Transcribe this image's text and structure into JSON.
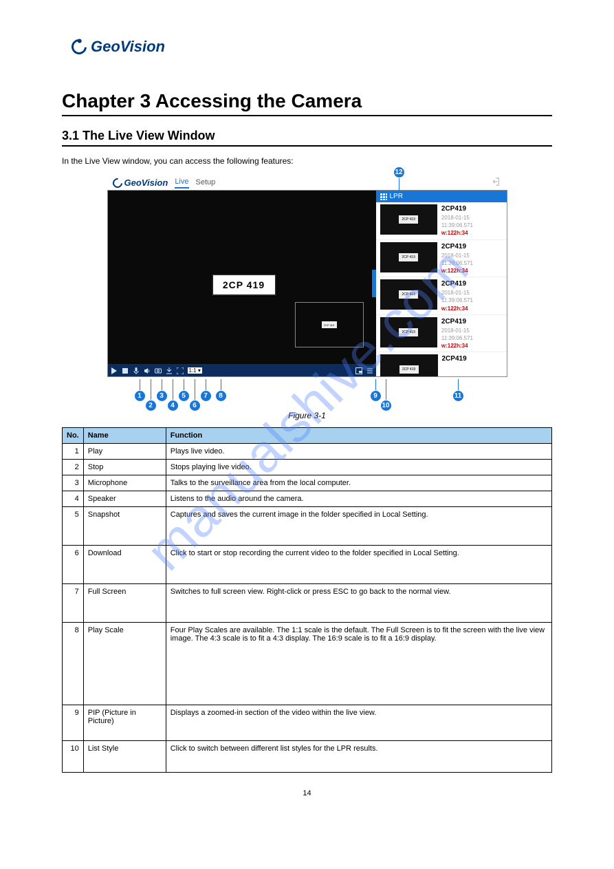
{
  "header": {
    "logo_text": "GeoVision"
  },
  "chapter_title": "Chapter 3 Accessing the Camera",
  "section_title": "3.1 The Live View Window",
  "intro": "In the Live View window, you can access the following features:",
  "screenshot": {
    "logo_text": "GeoVision",
    "tab_live": "Live",
    "tab_setup": "Setup",
    "plate_text": "2CP 419",
    "lpr_header": "LPR",
    "toolbar_ratio": "1:1 ▾",
    "lpr_items": [
      {
        "plate": "2CP419",
        "thumb_text": "2CP 419",
        "ts": "2018-01-15 11:39:06.571",
        "wh": "w:122h:34"
      },
      {
        "plate": "2CP419",
        "thumb_text": "2CP 419",
        "ts": "2018-01-15 11:39:06.571",
        "wh": "w:122h:34"
      },
      {
        "plate": "2CP419",
        "thumb_text": "2CP 419",
        "ts": "2018-01-15 11:39:06.571",
        "wh": "w:122h:34"
      },
      {
        "plate": "2CP419",
        "thumb_text": "2CP 419",
        "ts": "2018-01-15 11:39:06.571",
        "wh": "w:122h:34"
      },
      {
        "plate": "2CP419",
        "thumb_text": "2CP 419",
        "ts": "",
        "wh": ""
      }
    ],
    "callouts": [
      "1",
      "2",
      "3",
      "4",
      "5",
      "6",
      "7",
      "8",
      "9",
      "10",
      "11",
      "12"
    ]
  },
  "figure_caption": "Figure 3-1",
  "table": {
    "headers": {
      "no": "No.",
      "name": "Name",
      "func": "Function"
    },
    "rows": [
      {
        "no": "1",
        "name": "Play",
        "func": "Plays live video."
      },
      {
        "no": "2",
        "name": "Stop",
        "func": "Stops playing live video."
      },
      {
        "no": "3",
        "name": "Microphone",
        "func": "Talks to the surveillance area from the local computer."
      },
      {
        "no": "4",
        "name": "Speaker",
        "func": "Listens to the audio around the camera."
      },
      {
        "no": "5",
        "name": "Snapshot",
        "func": "Captures and saves the current image in the folder specified in Local Setting."
      },
      {
        "no": "6",
        "name": "Download",
        "func": "Click to start or stop recording the current video to the folder specified in Local Setting."
      },
      {
        "no": "7",
        "name": "Full Screen",
        "func": "Switches to full screen view. Right-click or press ESC to go back to the normal view."
      },
      {
        "no": "8",
        "name": "Play Scale",
        "func": "Four Play Scales are available. The 1:1 scale is the default. The Full Screen is to fit the screen with the live view image. The 4:3 scale is to fit a 4:3 display. The 16:9 scale is to fit a 16:9 display."
      },
      {
        "no": "9",
        "name": "PIP (Picture in Picture)",
        "func": "Displays a zoomed-in section of the video within the live view."
      },
      {
        "no": "10",
        "name": "List Style",
        "func": "Click to switch between different list styles for the LPR results."
      }
    ]
  },
  "page_number": "14",
  "watermark": "manualshive.com"
}
